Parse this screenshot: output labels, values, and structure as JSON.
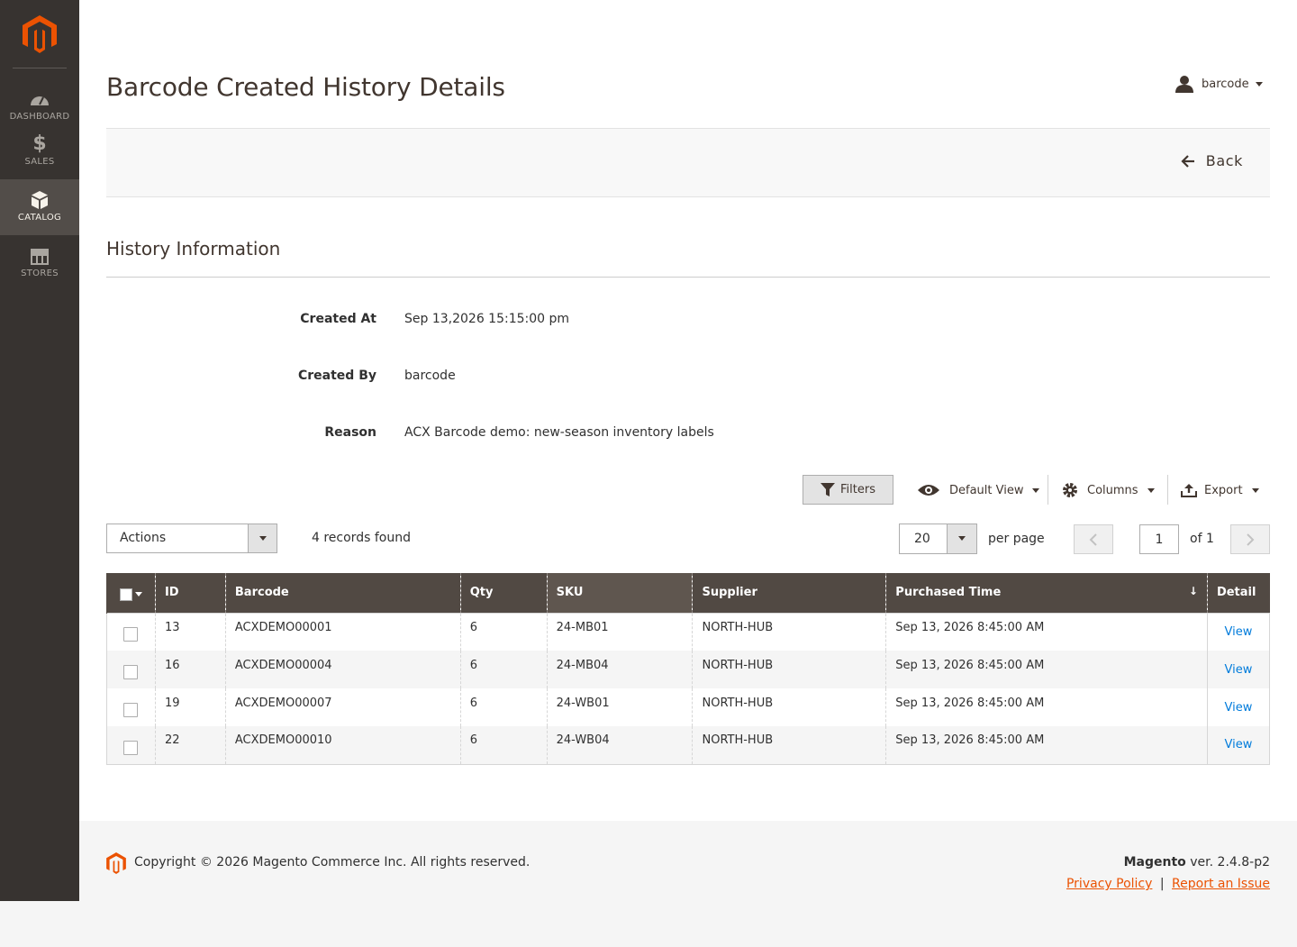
{
  "sidebar": {
    "logo_icon": "magento-logo-icon",
    "items": [
      {
        "label": "DASHBOARD",
        "icon": "dashboard-icon",
        "active": false
      },
      {
        "label": "SALES",
        "icon": "dollar-icon",
        "active": false
      },
      {
        "label": "CATALOG",
        "icon": "box-icon",
        "active": true
      },
      {
        "label": "STORES",
        "icon": "store-icon",
        "active": false
      }
    ]
  },
  "header": {
    "title": "Barcode Created History Details",
    "user": "barcode",
    "back_label": "Back"
  },
  "history": {
    "section_title": "History Information",
    "fields": [
      {
        "label": "Created At",
        "value": "Sep 13,2026 15:15:00 pm"
      },
      {
        "label": "Created By",
        "value": "barcode"
      },
      {
        "label": "Reason",
        "value": "ACX Barcode demo: new-season inventory labels"
      }
    ]
  },
  "toolbar": {
    "filters": "Filters",
    "default_view": "Default View",
    "columns": "Columns",
    "export": "Export",
    "actions": "Actions",
    "records_found": "4 records found",
    "per_page_value": "20",
    "per_page_label": "per page",
    "page_value": "1",
    "of_label": "of 1"
  },
  "grid": {
    "columns": [
      "ID",
      "Barcode",
      "Qty",
      "SKU",
      "Supplier",
      "Purchased Time",
      "Detail"
    ],
    "sort_indicator": "↓",
    "rows": [
      {
        "id": "13",
        "barcode": "ACXDEMO00001",
        "qty": "6",
        "sku": "24-MB01",
        "supplier": "NORTH-HUB",
        "time": "Sep 13, 2026 8:45:00 AM",
        "detail": "View"
      },
      {
        "id": "16",
        "barcode": "ACXDEMO00004",
        "qty": "6",
        "sku": "24-MB04",
        "supplier": "NORTH-HUB",
        "time": "Sep 13, 2026 8:45:00 AM",
        "detail": "View"
      },
      {
        "id": "19",
        "barcode": "ACXDEMO00007",
        "qty": "6",
        "sku": "24-WB01",
        "supplier": "NORTH-HUB",
        "time": "Sep 13, 2026 8:45:00 AM",
        "detail": "View"
      },
      {
        "id": "22",
        "barcode": "ACXDEMO00010",
        "qty": "6",
        "sku": "24-WB04",
        "supplier": "NORTH-HUB",
        "time": "Sep 13, 2026 8:45:00 AM",
        "detail": "View"
      }
    ]
  },
  "footer": {
    "copyright": "Copyright © 2026 Magento Commerce Inc. All rights reserved.",
    "brand": "Magento",
    "version": " ver. 2.4.8-p2",
    "privacy": "Privacy Policy",
    "separator": "|",
    "report": "Report an Issue"
  },
  "colors": {
    "sidebar_bg": "#373330",
    "sidebar_active": "#524d49",
    "grid_header": "#514943",
    "accent": "#eb5202",
    "link": "#007bdb"
  }
}
